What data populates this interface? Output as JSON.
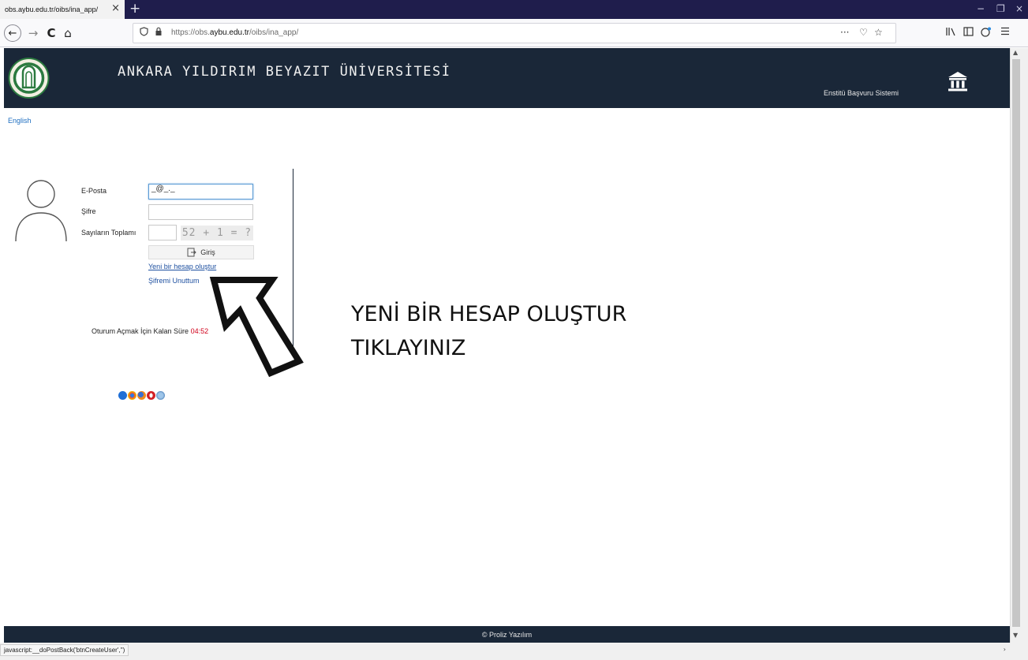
{
  "browser": {
    "tab_title": "obs.aybu.edu.tr/oibs/ina_app/",
    "tab_close": "×",
    "new_tab": "+",
    "window_controls": {
      "minimize": "−",
      "restore": "❐",
      "close": "×"
    },
    "nav": {
      "back": "←",
      "forward": "→",
      "reload": "C",
      "home": "⌂"
    },
    "url": {
      "prefix": "https://obs.",
      "domain": "aybu.edu.tr",
      "suffix": "/oibs/ina_app/"
    },
    "url_actions": {
      "more": "···",
      "pocket": "♡",
      "bookmark": "☆"
    },
    "toolbar_icons": [
      "library-icon",
      "sidebar-icon",
      "account-icon",
      "menu-icon"
    ],
    "status_text": "javascript:__doPostBack('btnCreateUser','')"
  },
  "header": {
    "university_name": "ANKARA YILDIRIM BEYAZIT ÜNİVERSİTESİ",
    "system_name": "Enstitü Başvuru Sistemi",
    "background_color": "#1a2738"
  },
  "language_link": "English",
  "login_form": {
    "email_label": "E-Posta",
    "email_value": "_@_._",
    "password_label": "Şifre",
    "password_value": "",
    "captcha_label": "Sayıların Toplamı",
    "captcha_value": "",
    "captcha_image_text": "52 + 1 = ?",
    "login_button": "Giriş",
    "create_account_link": "Yeni bir hesap oluştur",
    "forgot_password_link": "Şifremi Unuttum"
  },
  "session": {
    "label": "Oturum Açmak İçin Kalan Süre",
    "time": "04:52",
    "time_color": "#d0021b"
  },
  "supported_browsers": [
    "ie-icon",
    "chrome-icon",
    "firefox-icon",
    "opera-icon",
    "safari-icon"
  ],
  "annotation": {
    "line1": "YENİ BİR HESAP OLUŞTUR",
    "line2": "TIKLAYINIZ"
  },
  "footer": {
    "copyright": "© Proliz Yazılım"
  }
}
